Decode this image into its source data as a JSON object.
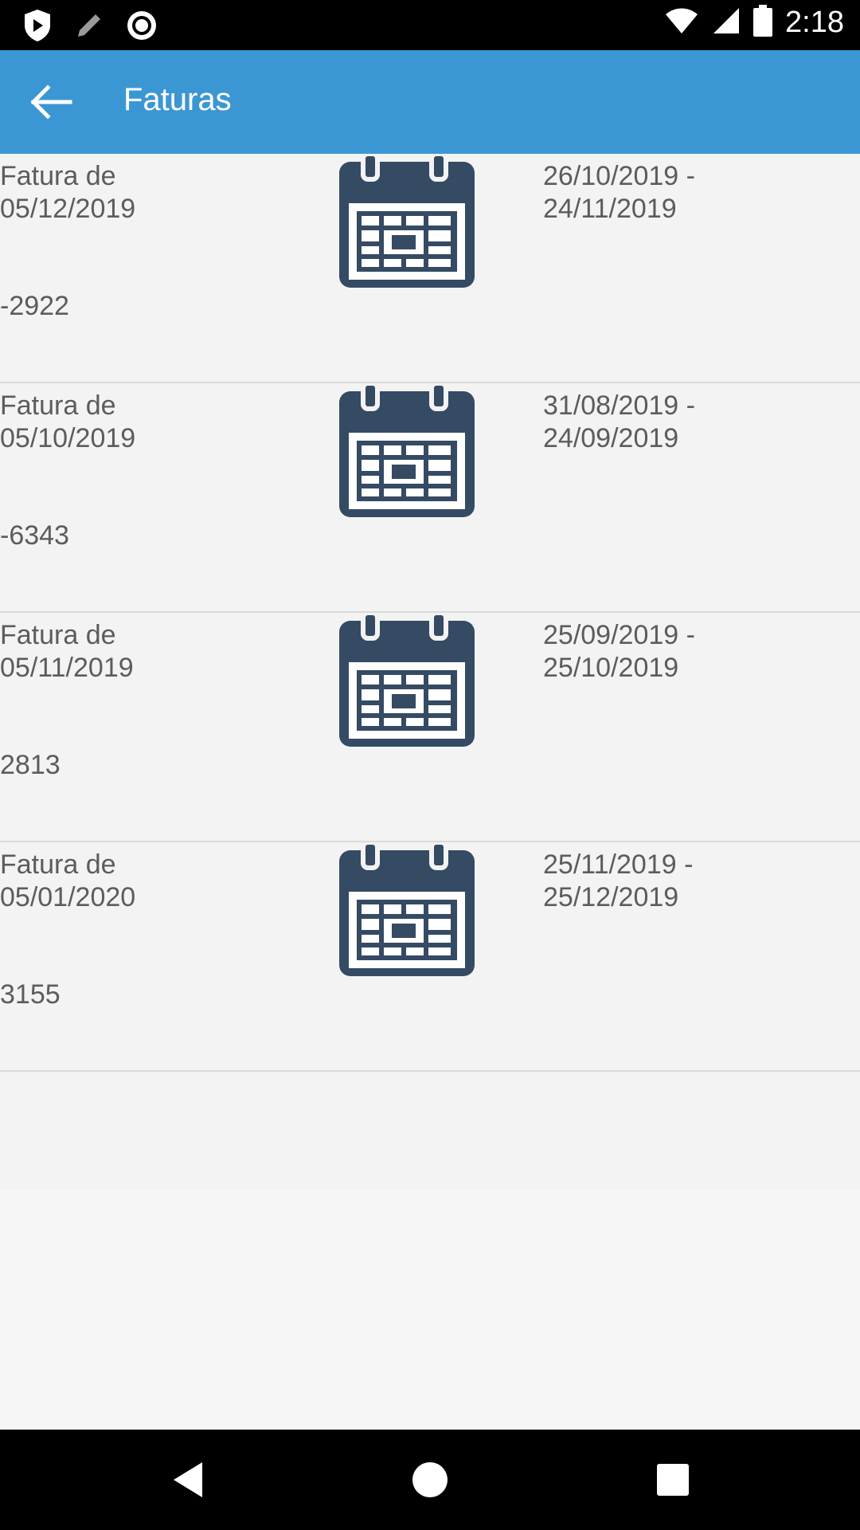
{
  "status_bar": {
    "time": "2:18"
  },
  "app_bar": {
    "title": "Faturas"
  },
  "invoices": [
    {
      "title": "Fatura de 05/12/2019",
      "amount": "-2922",
      "period": "26/10/2019 - 24/11/2019"
    },
    {
      "title": "Fatura de 05/10/2019",
      "amount": "-6343",
      "period": "31/08/2019 - 24/09/2019"
    },
    {
      "title": "Fatura de 05/11/2019",
      "amount": "2813",
      "period": "25/09/2019 - 25/10/2019"
    },
    {
      "title": "Fatura de 05/01/2020",
      "amount": "3155",
      "period": "25/11/2019 - 25/12/2019"
    }
  ],
  "colors": {
    "app_bar": "#3b97d3",
    "calendar_icon": "#354a63"
  }
}
